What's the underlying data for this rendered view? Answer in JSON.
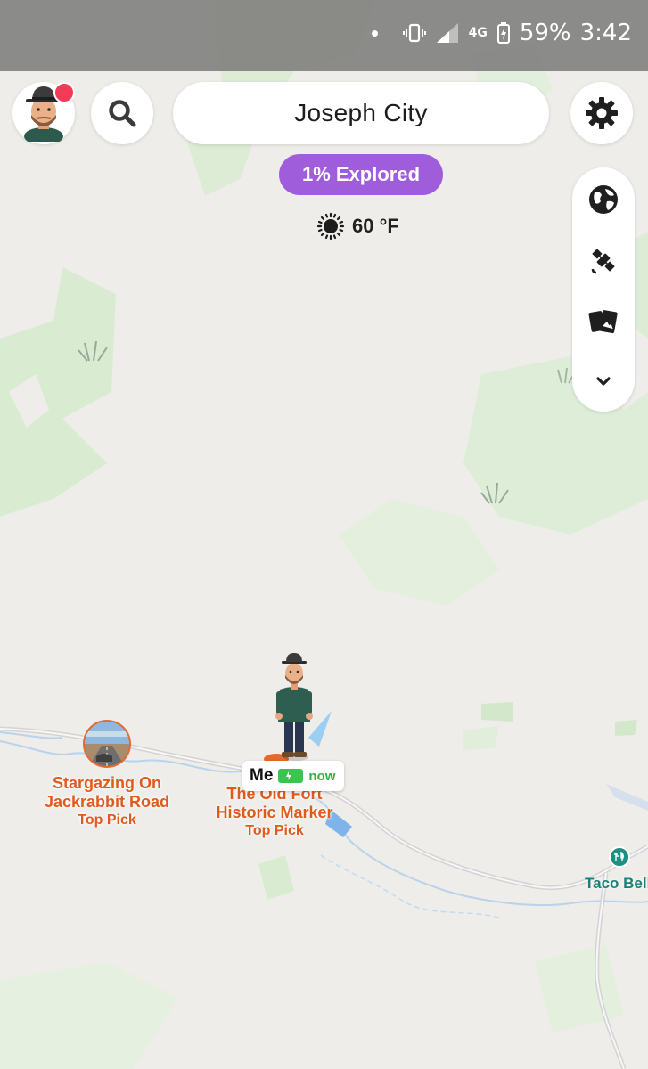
{
  "status_bar": {
    "battery_percent": "59%",
    "time": "3:42",
    "network": "4G"
  },
  "header": {
    "location_name": "Joseph City",
    "explored_badge": "1% Explored",
    "weather_temp": "60 °F"
  },
  "side_toolbar": {
    "icons": [
      "globe-icon",
      "satellite-icon",
      "memories-cards-icon",
      "chevron-down-icon"
    ]
  },
  "map": {
    "places": [
      {
        "title_line1": "Stargazing On",
        "title_line2": "Jackrabbit Road",
        "subtitle": "Top Pick"
      },
      {
        "title_line1": "The Old Fort",
        "title_line2": "Historic Marker",
        "subtitle": "Top Pick"
      }
    ],
    "me_tag": {
      "label": "Me",
      "status": "now"
    },
    "poi": {
      "label": "Taco Bell"
    }
  },
  "colors": {
    "accent_purple": "#a05ddb",
    "place_orange": "#e05a1e",
    "notification_red": "#f23c57",
    "battery_green": "#3cc54e",
    "poi_teal": "#1d7f78"
  }
}
